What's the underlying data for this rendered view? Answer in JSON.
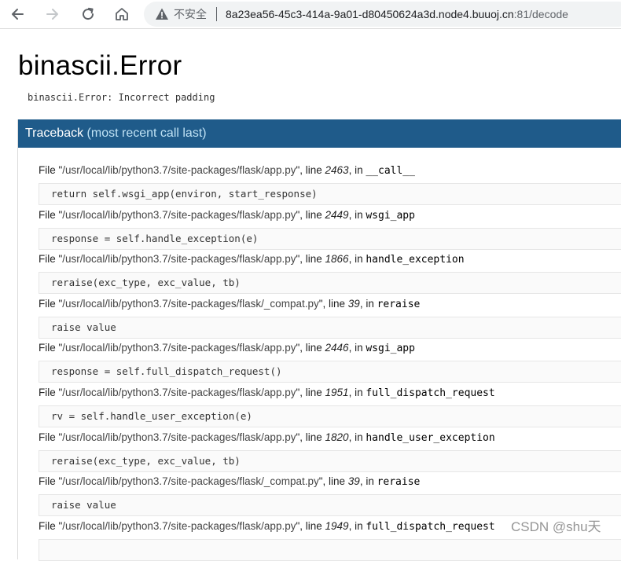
{
  "browser": {
    "insecure_label": "不安全",
    "url_host": "8a23ea56-45c3-414a-9a01-d80450624a3d.node4.buuoj.cn",
    "url_rest": ":81/decode",
    "icons": {
      "back": "arrow-left-icon",
      "forward": "arrow-right-icon",
      "reload": "reload-icon",
      "home": "home-icon",
      "warning": "warning-triangle-icon"
    }
  },
  "error": {
    "title": "binascii.Error",
    "message": "binascii.Error: Incorrect padding"
  },
  "traceback": {
    "header_main": "Traceback",
    "header_sub": " (most recent call last)",
    "frames": [
      {
        "file_prefix": "File \"",
        "path": "/usr/local/lib/python3.7/site-packages/flask/app.py",
        "file_suffix": "\", line ",
        "line": "2463",
        "in_text": ", in ",
        "func": "__call__",
        "code": "return self.wsgi_app(environ, start_response)"
      },
      {
        "file_prefix": "File \"",
        "path": "/usr/local/lib/python3.7/site-packages/flask/app.py",
        "file_suffix": "\", line ",
        "line": "2449",
        "in_text": ", in ",
        "func": "wsgi_app",
        "code": "response = self.handle_exception(e)"
      },
      {
        "file_prefix": "File \"",
        "path": "/usr/local/lib/python3.7/site-packages/flask/app.py",
        "file_suffix": "\", line ",
        "line": "1866",
        "in_text": ", in ",
        "func": "handle_exception",
        "code": "reraise(exc_type, exc_value, tb)"
      },
      {
        "file_prefix": "File \"",
        "path": "/usr/local/lib/python3.7/site-packages/flask/_compat.py",
        "file_suffix": "\", line ",
        "line": "39",
        "in_text": ", in ",
        "func": "reraise",
        "code": "raise value"
      },
      {
        "file_prefix": "File \"",
        "path": "/usr/local/lib/python3.7/site-packages/flask/app.py",
        "file_suffix": "\", line ",
        "line": "2446",
        "in_text": ", in ",
        "func": "wsgi_app",
        "code": "response = self.full_dispatch_request()"
      },
      {
        "file_prefix": "File \"",
        "path": "/usr/local/lib/python3.7/site-packages/flask/app.py",
        "file_suffix": "\", line ",
        "line": "1951",
        "in_text": ", in ",
        "func": "full_dispatch_request",
        "code": "rv = self.handle_user_exception(e)"
      },
      {
        "file_prefix": "File \"",
        "path": "/usr/local/lib/python3.7/site-packages/flask/app.py",
        "file_suffix": "\", line ",
        "line": "1820",
        "in_text": ", in ",
        "func": "handle_user_exception",
        "code": "reraise(exc_type, exc_value, tb)"
      },
      {
        "file_prefix": "File \"",
        "path": "/usr/local/lib/python3.7/site-packages/flask/_compat.py",
        "file_suffix": "\", line ",
        "line": "39",
        "in_text": ", in ",
        "func": "reraise",
        "code": "raise value"
      },
      {
        "file_prefix": "File \"",
        "path": "/usr/local/lib/python3.7/site-packages/flask/app.py",
        "file_suffix": "\", line ",
        "line": "1949",
        "in_text": ", in ",
        "func": "full_dispatch_request",
        "code": ""
      }
    ]
  },
  "watermark": "CSDN @shu天"
}
